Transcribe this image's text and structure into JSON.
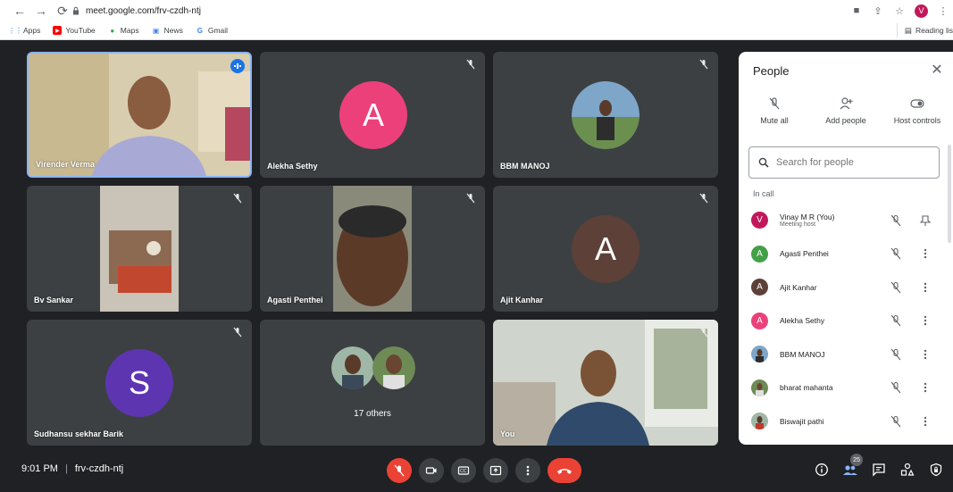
{
  "browser": {
    "url": "meet.google.com/frv-czdh-ntj",
    "profile_initial": "V",
    "bookmarks": [
      "Apps",
      "YouTube",
      "Maps",
      "News",
      "Gmail"
    ],
    "reading_list": "Reading lis"
  },
  "tiles": [
    {
      "name": "Virender Verma"
    },
    {
      "name": "Alekha Sethy",
      "initial": "A"
    },
    {
      "name": "BBM MANOJ"
    },
    {
      "name": "Bv Sankar"
    },
    {
      "name": "Agasti Penthei"
    },
    {
      "name": "Ajit Kanhar",
      "initial": "A"
    },
    {
      "name": "Sudhansu sekhar Barik",
      "initial": "S"
    },
    {
      "others": "17 others"
    },
    {
      "name": "You"
    }
  ],
  "panel": {
    "title": "People",
    "actions": [
      "Mute all",
      "Add people",
      "Host controls"
    ],
    "search_placeholder": "Search for people",
    "section": "In call",
    "people": [
      {
        "initial": "V",
        "name": "Vinay M R (You)",
        "sub": "Meeting host",
        "color": "#c2185b"
      },
      {
        "initial": "A",
        "name": "Agasti Penthei",
        "color": "#43a047"
      },
      {
        "initial": "A",
        "name": "Ajit Kanhar",
        "color": "#5d4037"
      },
      {
        "initial": "A",
        "name": "Alekha Sethy",
        "color": "#ec407a"
      },
      {
        "initial": "",
        "name": "BBM MANOJ"
      },
      {
        "initial": "",
        "name": "bharat mahanta"
      },
      {
        "initial": "",
        "name": "Biswajit pathi"
      }
    ]
  },
  "bottom": {
    "time": "9:01 PM",
    "meeting_code": "frv-czdh-ntj",
    "participant_count": "25"
  }
}
